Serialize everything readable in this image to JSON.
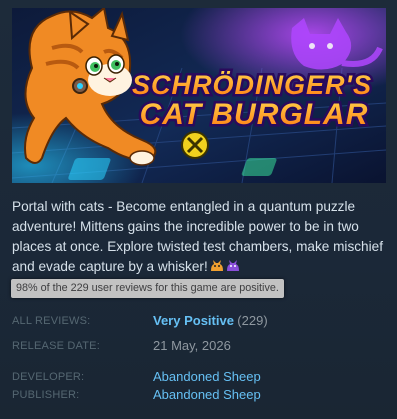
{
  "header_image": {
    "title_line1": "SCHRÖDINGER'S",
    "title_line2": "CAT BURGLAR"
  },
  "description": {
    "text": "Portal with cats - Become entangled in a quantum puzzle adventure! Mittens gains the incredible power to be in two places at once. Explore twisted test chambers, make mischief and evade capture by a whisker!",
    "emoji_icons": [
      "orange-cat-emoji-icon",
      "purple-cat-emoji-icon"
    ]
  },
  "review_tooltip": {
    "text": "98% of the 229 user reviews for this game are positive."
  },
  "reviews": {
    "label": "ALL REVIEWS:",
    "summary": "Very Positive",
    "count": "(229)"
  },
  "release": {
    "label": "RELEASE DATE:",
    "date": "21 May, 2026"
  },
  "developer": {
    "label": "DEVELOPER:",
    "name": "Abandoned Sheep"
  },
  "publisher": {
    "label": "PUBLISHER:",
    "name": "Abandoned Sheep"
  },
  "colors": {
    "background": "#1b2838",
    "link": "#66c0f4",
    "label": "#556772",
    "muted": "#8f98a0",
    "title_orange": "#ff9a1f",
    "title_outline": "#2a0a5c"
  }
}
